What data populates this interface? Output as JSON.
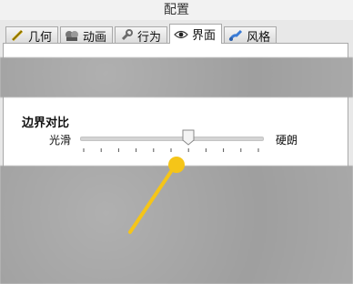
{
  "window": {
    "title": "配置"
  },
  "tabs": [
    {
      "label": "几何",
      "icon": "ruler-icon"
    },
    {
      "label": "动画",
      "icon": "film-reel-icon"
    },
    {
      "label": "行为",
      "icon": "wrench-icon"
    },
    {
      "label": "界面",
      "icon": "eye-icon",
      "active": true
    },
    {
      "label": "风格",
      "icon": "brush-icon"
    }
  ],
  "contrast": {
    "title": "边界对比",
    "min_label": "光滑",
    "max_label": "硬朗",
    "value_fraction": 0.6,
    "tick_count": 11
  },
  "colors": {
    "accent": "#f5c518"
  }
}
